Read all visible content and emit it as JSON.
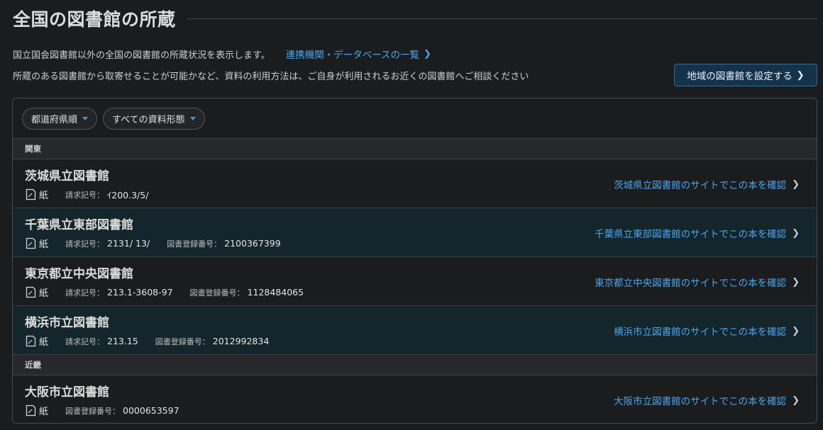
{
  "page": {
    "title": "全国の図書館の所蔵",
    "description_line1": "国立国会図書館以外の全国の図書館の所蔵状況を表示します。",
    "description_line2": "所蔵のある図書館から取寄せることが可能かなど、資料の利用方法は、ご自身が利用されるお近くの図書館へご相談ください",
    "databases_link": "連携機関・データベースの一覧",
    "set_region_button": "地域の図書館を設定する"
  },
  "filters": {
    "sort": "都道府県順",
    "material_type": "すべての資料形態"
  },
  "icons": {
    "chevron": "chevron-right-icon",
    "caret": "caret-down-icon",
    "paper": "paper-document-icon"
  },
  "colors": {
    "link": "#4aa8f0",
    "accent_caret": "#3d9ae0",
    "alt_row": "#14252b"
  },
  "regions": [
    {
      "name": "関東",
      "libraries": [
        {
          "name": "茨城県立図書館",
          "format": "紙",
          "call_number_label": "請求記号：",
          "call_number": "ｲ200.3/5/",
          "registration_label": "",
          "registration_number": "",
          "link": "茨城県立図書館のサイトでこの本を確認"
        },
        {
          "name": "千葉県立東部図書館",
          "format": "紙",
          "call_number_label": "請求記号：",
          "call_number": "2131/ 13/",
          "registration_label": "図書登録番号：",
          "registration_number": "2100367399",
          "link": "千葉県立東部図書館のサイトでこの本を確認"
        },
        {
          "name": "東京都立中央図書館",
          "format": "紙",
          "call_number_label": "請求記号：",
          "call_number": "213.1-3608-97",
          "registration_label": "図書登録番号：",
          "registration_number": "1128484065",
          "link": "東京都立中央図書館のサイトでこの本を確認"
        },
        {
          "name": "横浜市立図書館",
          "format": "紙",
          "call_number_label": "請求記号：",
          "call_number": "213.15",
          "registration_label": "図書登録番号：",
          "registration_number": "2012992834",
          "link": "横浜市立図書館のサイトでこの本を確認"
        }
      ]
    },
    {
      "name": "近畿",
      "libraries": [
        {
          "name": "大阪市立図書館",
          "format": "紙",
          "call_number_label": "",
          "call_number": "",
          "registration_label": "図書登録番号：",
          "registration_number": "0000653597",
          "link": "大阪市立図書館のサイトでこの本を確認"
        }
      ]
    }
  ]
}
